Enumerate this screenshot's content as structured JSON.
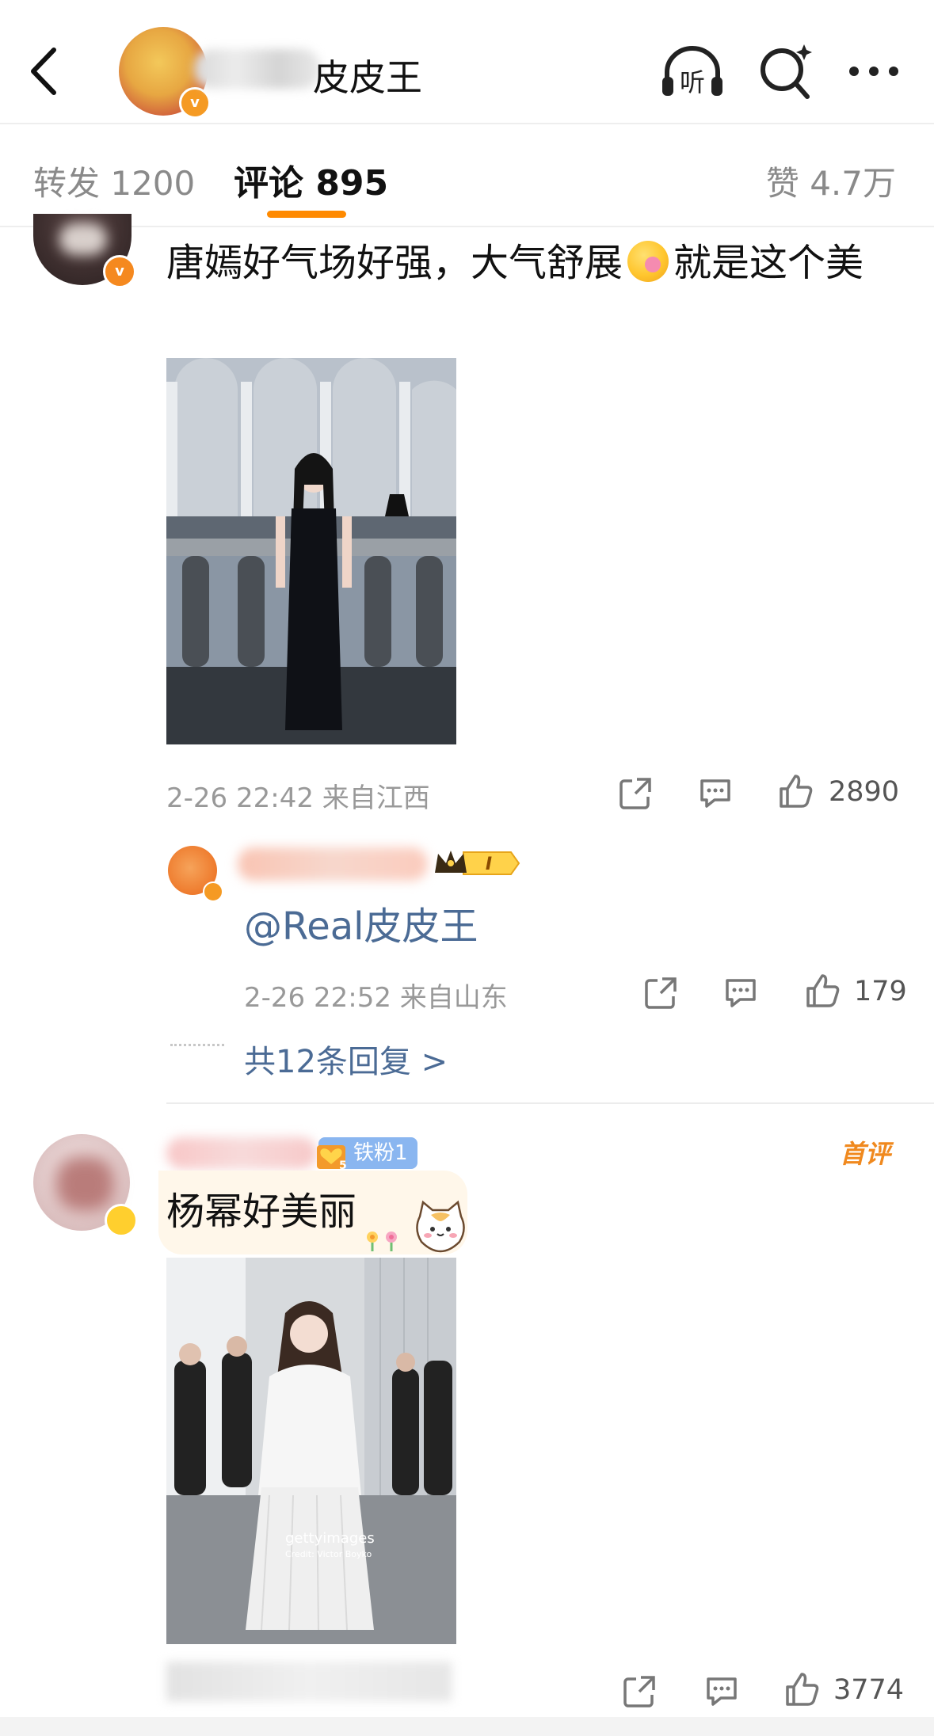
{
  "header": {
    "author_name_visible": "皮皮王",
    "back_icon": "chevron-left-icon",
    "listen_label": "听",
    "search_icon": "search-sparkle-icon",
    "more_icon": "more-dots-icon"
  },
  "tabs": {
    "repost": "转发 1200",
    "comment": "评论 895",
    "like": "赞 4.7万",
    "accent_color": "#ff8a00"
  },
  "comments": [
    {
      "text_before_emoji": "唐嫣好气场好强，大气舒展",
      "text_after_emoji": "就是这个美",
      "meta": "2-26 22:42 来自江西",
      "likes": "2890",
      "reply": {
        "text": "@Real皮皮王",
        "meta": "2-26 22:52 来自山东",
        "likes": "179",
        "crown_level": "I"
      },
      "more_replies": "共12条回复 >"
    },
    {
      "fan_badge": "铁粉1",
      "first_badge": "首评",
      "text": "杨幂好美丽",
      "photo_watermark": "gettyimages",
      "photo_credit": "Credit: Victor Boyko",
      "likes": "3774"
    }
  ],
  "colors": {
    "link_blue": "#4b6b95",
    "meta_gray": "#999999",
    "verified_orange": "#f5891f"
  }
}
